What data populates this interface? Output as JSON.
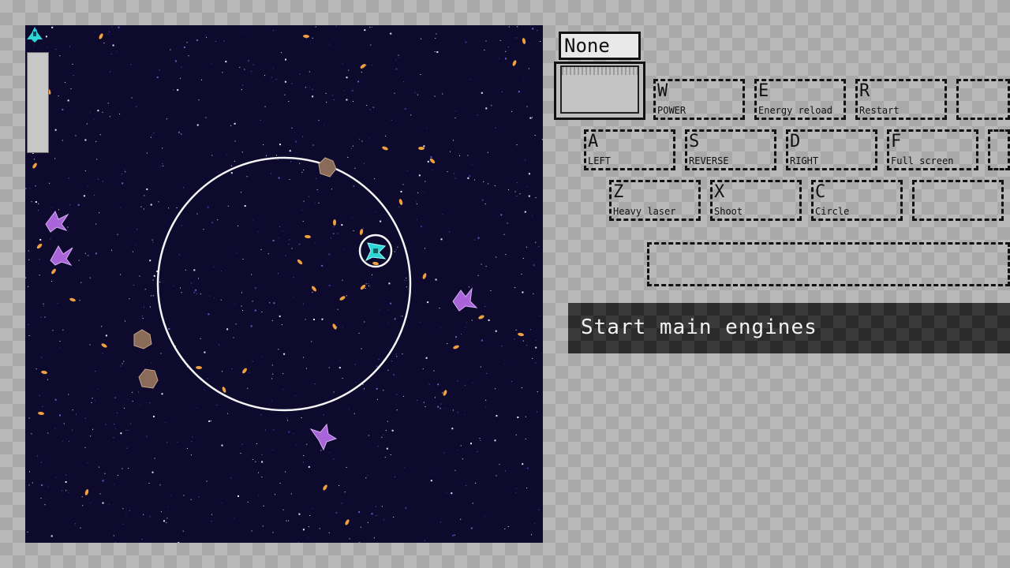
{
  "selector": {
    "title": "None"
  },
  "keys": [
    {
      "key": "W",
      "label": "POWER"
    },
    {
      "key": "E",
      "label": "Energy reload"
    },
    {
      "key": "R",
      "label": "Restart"
    },
    {
      "key": "",
      "label": ""
    },
    {
      "key": "A",
      "label": "LEFT"
    },
    {
      "key": "S",
      "label": "REVERSE"
    },
    {
      "key": "D",
      "label": "RIGHT"
    },
    {
      "key": "F",
      "label": "Full screen"
    },
    {
      "key": "",
      "label": ""
    },
    {
      "key": "Z",
      "label": "Heavy laser"
    },
    {
      "key": "X",
      "label": "Shoot"
    },
    {
      "key": "C",
      "label": "Circle"
    },
    {
      "key": "",
      "label": ""
    }
  ],
  "message": {
    "text": "Start main engines"
  },
  "hud": {
    "energy_level": 1.0
  },
  "colors": {
    "space": "#0d0a2e",
    "player": "#2fd4d4",
    "enemy": "#a864d8",
    "asteroid": "#8a6a58",
    "bullet": "#f0a040"
  },
  "icons": {
    "player": "player-ship-icon",
    "enemy": "enemy-ship-icon",
    "asteroid": "asteroid-icon"
  }
}
